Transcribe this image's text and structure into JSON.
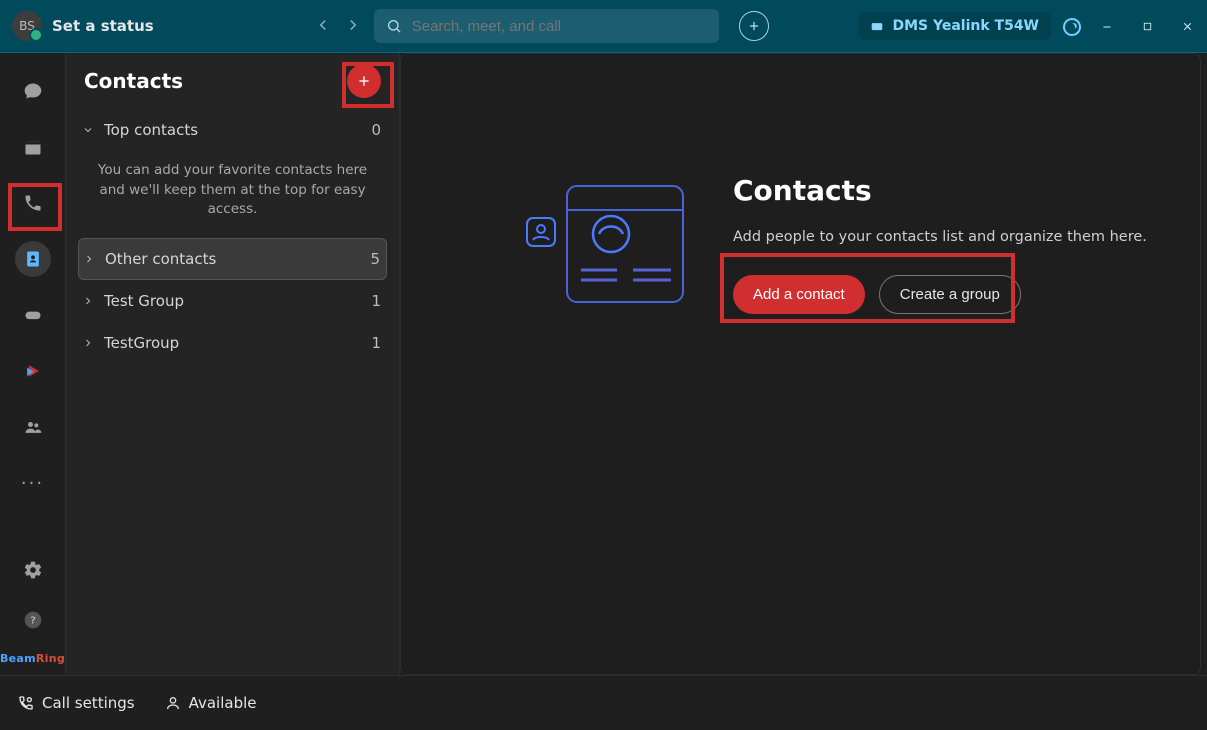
{
  "titlebar": {
    "avatar_initials": "BS",
    "set_status": "Set a status",
    "search_placeholder": "Search, meet, and call",
    "device_label": "DMS Yealink T54W"
  },
  "contacts_pane": {
    "title": "Contacts",
    "top_hint": "You can add your favorite contacts here and we'll keep them at the top for easy access.",
    "groups": [
      {
        "name": "Top contacts",
        "count": "0",
        "expanded": true
      },
      {
        "name": "Other contacts",
        "count": "5",
        "expanded": false,
        "selected": true
      },
      {
        "name": "Test Group",
        "count": "1",
        "expanded": false
      },
      {
        "name": "TestGroup",
        "count": "1",
        "expanded": false
      }
    ]
  },
  "main": {
    "heading": "Contacts",
    "subtext": "Add people to your contacts list and organize them here.",
    "primary_btn": "Add a contact",
    "secondary_btn": "Create a group"
  },
  "bottom": {
    "call_settings": "Call settings",
    "presence": "Available"
  },
  "brand": {
    "part1": "Beam",
    "part2": "Ring"
  }
}
